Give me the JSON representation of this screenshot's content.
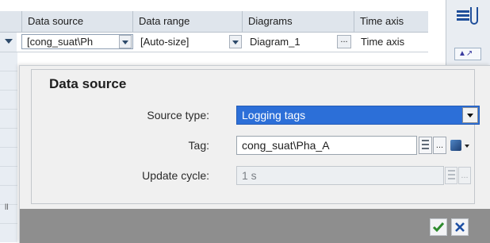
{
  "table": {
    "columns": [
      "Data source",
      "Data range",
      "Diagrams",
      "Time axis"
    ],
    "row": {
      "data_source": "[cong_suat\\Ph",
      "data_range": "[Auto-size]",
      "diagram": "Diagram_1",
      "ellipsis": "...",
      "time_axis": "Time axis"
    },
    "left_strip_mark": "ll"
  },
  "toolbar": {
    "icons": [
      "trend-settings-icon",
      "curve-icon"
    ]
  },
  "dialog": {
    "title": "Data source",
    "source_type_label": "Source type:",
    "source_type_value": "Logging tags",
    "tag_label": "Tag:",
    "tag_value": "cong_suat\\Pha_A",
    "update_cycle_label": "Update cycle:",
    "update_cycle_value": "1 s",
    "ellipsis": "..."
  },
  "colors": {
    "selection": "#2c6fd8",
    "ok_green": "#2e8b2e",
    "cancel_blue": "#1c4fa3"
  }
}
